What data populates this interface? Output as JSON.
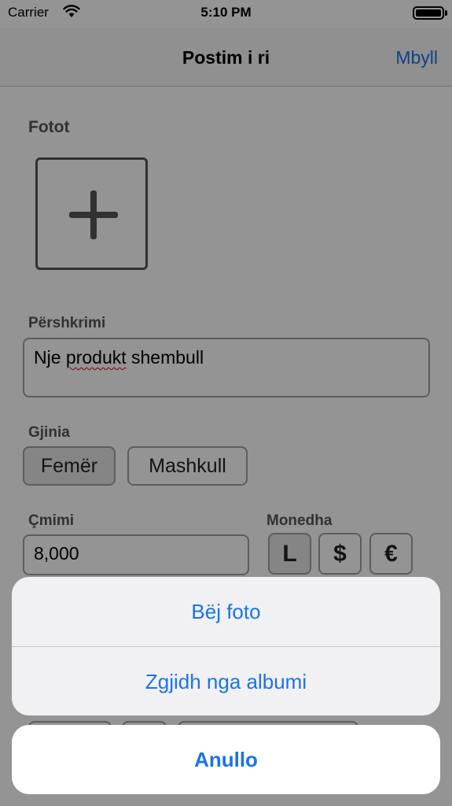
{
  "status_bar": {
    "carrier": "Carrier",
    "time": "5:10 PM"
  },
  "nav": {
    "title": "Postim i ri",
    "close_label": "Mbyll"
  },
  "form": {
    "photos_label": "Fotot",
    "description_label": "Përshkrimi",
    "description_value_prefix": "Nje ",
    "description_value_misspelled": "produkt",
    "description_value_suffix": " shembull",
    "gender_label": "Gjinia",
    "gender_options": [
      {
        "label": "Femër",
        "selected": true
      },
      {
        "label": "Mashkull",
        "selected": false
      }
    ],
    "price_label": "Çmimi",
    "price_value": "8,000",
    "currency_label": "Monedha",
    "currency_options": [
      {
        "label": "L",
        "selected": true
      },
      {
        "label": "$",
        "selected": false
      },
      {
        "label": "€",
        "selected": false
      }
    ]
  },
  "action_sheet": {
    "take_photo": "Bëj foto",
    "choose_album": "Zgjidh nga albumi",
    "cancel": "Anullo"
  },
  "colors": {
    "accent": "#1a73e8",
    "overlay": "rgba(0,0,0,0.42)"
  }
}
